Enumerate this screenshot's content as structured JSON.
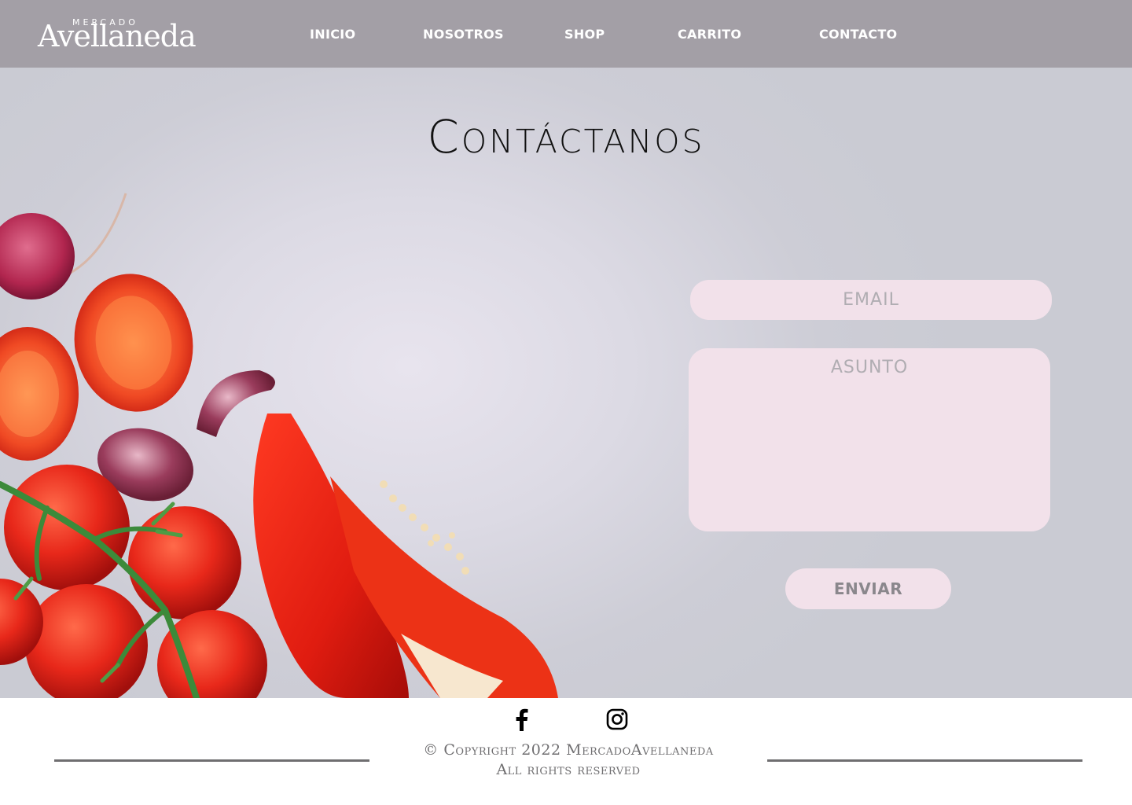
{
  "brand": {
    "small": "MERCADO",
    "name": "Avellaneda"
  },
  "nav": [
    {
      "label": "INICIO"
    },
    {
      "label": "NOSOTROS"
    },
    {
      "label": "SHOP"
    },
    {
      "label": "CARRITO"
    },
    {
      "label": "CONTACTO"
    }
  ],
  "hero": {
    "title": "Contáctanos"
  },
  "form": {
    "email_placeholder": "EMAIL",
    "subject_placeholder": "ASUNTO",
    "send_label": "ENVIAR"
  },
  "footer": {
    "social": [
      "facebook-icon",
      "instagram-icon"
    ],
    "copyright": "© Copyright 2022 MercadoAvellaneda",
    "rights": "All rights reserved"
  },
  "colors": {
    "header_bg": "#a39fa6",
    "field_bg": "#f2e1ea",
    "footer_text": "#6f6e70"
  }
}
